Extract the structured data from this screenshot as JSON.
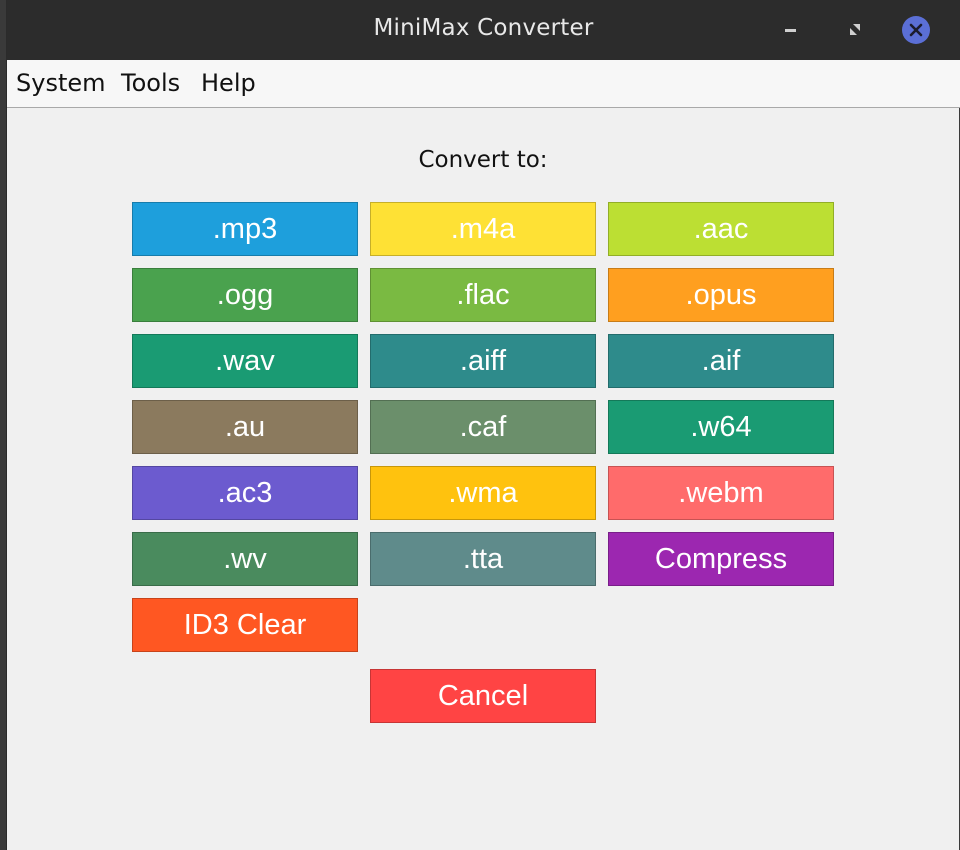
{
  "window": {
    "title": "MiniMax Converter",
    "controls": {
      "minimize_icon": "minimize-icon",
      "maximize_icon": "maximize-icon",
      "close_icon": "close-icon",
      "close_color": "#5b6fd6"
    }
  },
  "menubar": {
    "items": [
      "System",
      "Tools",
      "Help"
    ]
  },
  "main": {
    "heading": "Convert to:",
    "buttons": [
      {
        "label": ".mp3",
        "color": "#1e9fdc"
      },
      {
        "label": ".m4a",
        "color": "#fee135"
      },
      {
        "label": ".aac",
        "color": "#bcdf33"
      },
      {
        "label": ".ogg",
        "color": "#4aa24e"
      },
      {
        "label": ".flac",
        "color": "#7aba42"
      },
      {
        "label": ".opus",
        "color": "#ff9f1f"
      },
      {
        "label": ".wav",
        "color": "#1a9b73"
      },
      {
        "label": ".aiff",
        "color": "#2e8b8b"
      },
      {
        "label": ".aif",
        "color": "#2e8b8b"
      },
      {
        "label": ".au",
        "color": "#8b7a5e"
      },
      {
        "label": ".caf",
        "color": "#6b8f6b"
      },
      {
        "label": ".w64",
        "color": "#1a9b73"
      },
      {
        "label": ".ac3",
        "color": "#6c5bcf"
      },
      {
        "label": ".wma",
        "color": "#ffc20e"
      },
      {
        "label": ".webm",
        "color": "#ff6b6b"
      },
      {
        "label": ".wv",
        "color": "#4a8b5e"
      },
      {
        "label": ".tta",
        "color": "#5f8b8b"
      },
      {
        "label": "Compress",
        "color": "#9c27b0"
      },
      {
        "label": "ID3 Clear",
        "color": "#ff5722"
      }
    ],
    "cancel": {
      "label": "Cancel",
      "color": "#ff4444"
    }
  }
}
